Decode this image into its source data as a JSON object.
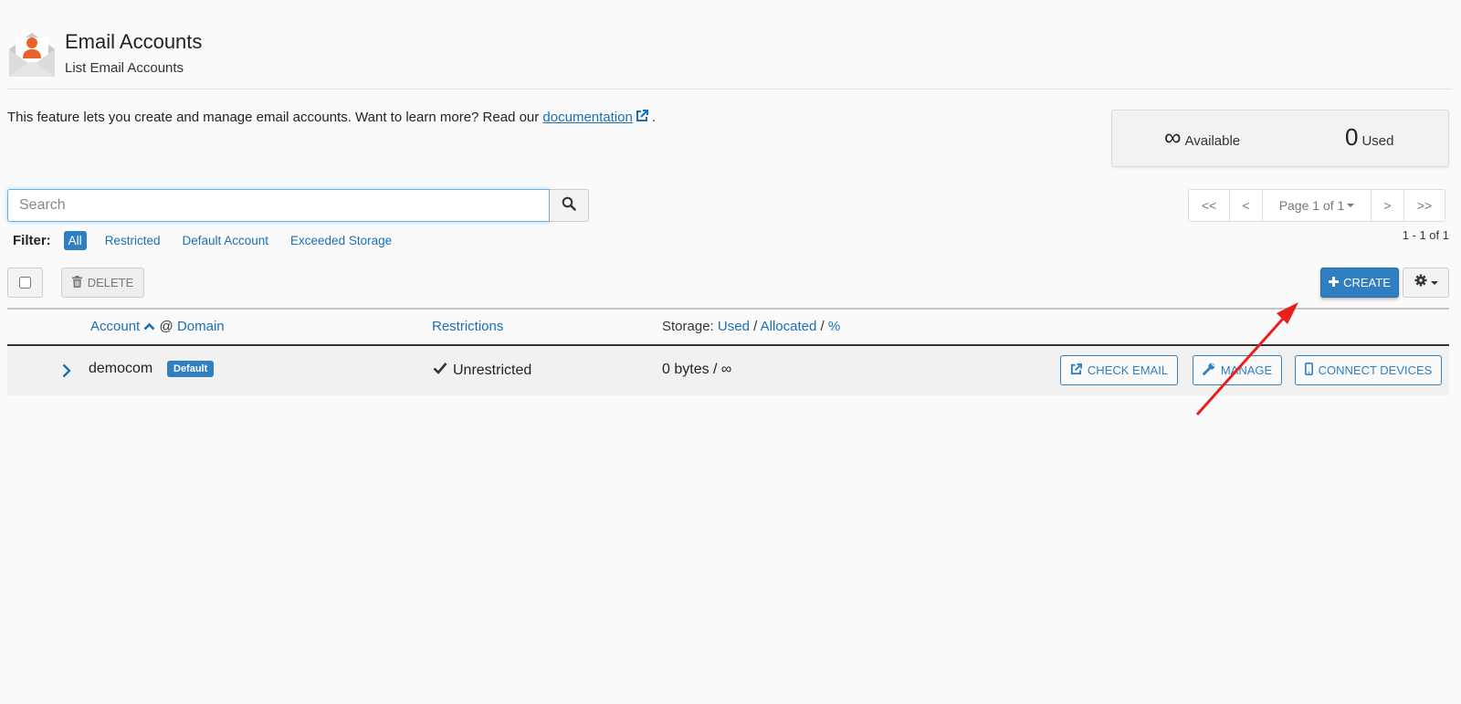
{
  "header": {
    "title": "Email Accounts",
    "subtitle": "List Email Accounts",
    "icon": "envelope-user-icon"
  },
  "intro": {
    "text_before": "This feature lets you create and manage email accounts. Want to learn more? Read our ",
    "link_label": "documentation",
    "text_after": " ."
  },
  "stats": {
    "available_value": "∞",
    "available_label": "Available",
    "used_value": "0",
    "used_label": "Used"
  },
  "search": {
    "placeholder": "Search",
    "value": ""
  },
  "filters": {
    "label": "Filter:",
    "items": [
      "All",
      "Restricted",
      "Default Account",
      "Exceeded Storage"
    ],
    "active": "All"
  },
  "pagination": {
    "first": "<<",
    "prev": "<",
    "page_label": "Page 1 of 1",
    "next": ">",
    "last": ">>",
    "range": "1 - 1 of 1"
  },
  "toolbar": {
    "delete_label": "DELETE",
    "create_label": "CREATE"
  },
  "table": {
    "headers": {
      "account": "Account",
      "at": "@",
      "domain": "Domain",
      "restrictions": "Restrictions",
      "storage_prefix": "Storage:",
      "used": "Used",
      "sep1": "/",
      "allocated": "Allocated",
      "sep2": "/",
      "percent": "%"
    },
    "rows": [
      {
        "account": "democom",
        "badge": "Default",
        "restriction": "Unrestricted",
        "storage": "0 bytes / ∞",
        "actions": {
          "check_email": "CHECK EMAIL",
          "manage": "MANAGE",
          "connect_devices": "CONNECT DEVICES"
        }
      }
    ]
  },
  "colors": {
    "primary": "#2f7fc1",
    "link": "#1a6fb3",
    "annotation": "#e8201c"
  }
}
